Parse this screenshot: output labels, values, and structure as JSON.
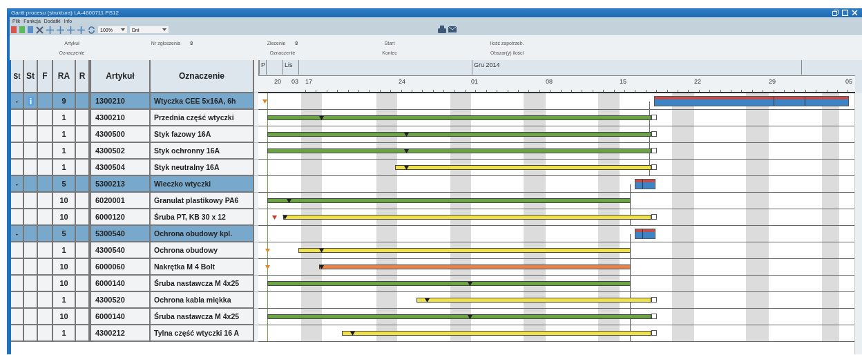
{
  "window": {
    "title": "Gantt procesu (struktura) LA-4600711 PS12"
  },
  "menu": [
    "Plik",
    "Funkcja",
    "Dodatki",
    "Info"
  ],
  "toolbar": {
    "zoom": "100%",
    "unit": "Dni"
  },
  "filters": [
    {
      "top": {
        "label": "Artykuł"
      },
      "bottom": {
        "label": "Oznaczenie"
      }
    },
    {
      "top": {
        "label": "Nr zgłoszenia",
        "value": "8"
      }
    },
    {
      "top": {
        "label": "Zlecenie",
        "value": "8"
      },
      "bottom": {
        "label": "Oznaczenie"
      }
    },
    {
      "top": {
        "label": "Start"
      },
      "bottom": {
        "label": "Koniec"
      }
    },
    {
      "top": {
        "label": "Ilość zapotrzeb."
      },
      "bottom": {
        "label": "Obszar(y) ilości"
      }
    }
  ],
  "columns": [
    "St",
    "St",
    "F",
    "RA",
    "R",
    "Artykuł",
    "Oznaczenie"
  ],
  "timeline": {
    "months": [
      "P",
      "Lis",
      "Gru 2014"
    ],
    "days": [
      "20",
      "03",
      "17",
      "24",
      "01",
      "08",
      "15",
      "22",
      "29",
      "05"
    ]
  },
  "rows": [
    {
      "kind": "summary",
      "expand": "-",
      "info": true,
      "ra": "9",
      "article": "1300210",
      "name": "Wtyczka CEE 5x16A, 6h",
      "markers": [
        {
          "color": "#d9822b"
        }
      ]
    },
    {
      "kind": "item",
      "ra": "1",
      "article": "4300210",
      "name": "Przednia część wtyczki",
      "color": "#6aa443",
      "markers": [
        {
          "color": "#1f1f1f"
        }
      ],
      "linked": true
    },
    {
      "kind": "item",
      "ra": "1",
      "article": "4300500",
      "name": "Styk fazowy 16A",
      "color": "#6aa443",
      "markers": [
        {
          "color": "#1f1f1f"
        }
      ],
      "linked": true
    },
    {
      "kind": "item",
      "ra": "1",
      "article": "4300502",
      "name": "Styk ochronny 16A",
      "color": "#6aa443",
      "markers": [
        {
          "color": "#1f1f1f"
        }
      ],
      "linked": true
    },
    {
      "kind": "item",
      "ra": "1",
      "article": "4300504",
      "name": "Styk neutralny 16A",
      "color": "#f0e04a",
      "markers": [
        {
          "color": "#1f1f1f"
        }
      ],
      "linked": true
    },
    {
      "kind": "summary",
      "expand": "-",
      "info": false,
      "ra": "5",
      "article": "5300213",
      "name": "Wieczko wtyczki"
    },
    {
      "kind": "item",
      "ra": "10",
      "article": "6020001",
      "name": "Granulat plastikowy PA6",
      "color": "#6aa443",
      "markers": [
        {
          "color": "#1f1f1f"
        }
      ],
      "linked": false
    },
    {
      "kind": "item",
      "ra": "10",
      "article": "6000120",
      "name": "Śruba PT, KB 30 x 12",
      "color": "#f0e04a",
      "markers": [
        {
          "color": "#c0392b"
        },
        {
          "color": "#1f1f1f"
        }
      ],
      "linked": true
    },
    {
      "kind": "summary",
      "expand": "-",
      "info": false,
      "ra": "5",
      "article": "5300540",
      "name": "Ochrona obudowy kpl."
    },
    {
      "kind": "item",
      "ra": "1",
      "article": "4300540",
      "name": "Ochrona obudowy",
      "color": "#f0e04a",
      "markers": [
        {
          "color": "#d98a2b"
        },
        {
          "color": "#1f1f1f"
        }
      ],
      "linked": false
    },
    {
      "kind": "item",
      "ra": "10",
      "article": "6000060",
      "name": "Nakrętka M 4  Bolt",
      "color": "#e8834a",
      "markers": [
        {
          "color": "#d98a2b"
        },
        {
          "color": "#1f1f1f"
        }
      ],
      "linked": false
    },
    {
      "kind": "item",
      "ra": "10",
      "article": "6000140",
      "name": "Śruba nastawcza M 4x25",
      "color": "#6aa443",
      "markers": [
        {
          "color": "#1f1f1f"
        }
      ],
      "linked": false
    },
    {
      "kind": "item",
      "ra": "1",
      "article": "4300520",
      "name": "Ochrona kabla miękka",
      "color": "#f0e04a",
      "markers": [
        {
          "color": "#1f1f1f"
        }
      ],
      "linked": true
    },
    {
      "kind": "item",
      "ra": "10",
      "article": "6000140",
      "name": "Śruba nastawcza M 4x25",
      "color": "#6aa443",
      "markers": [
        {
          "color": "#1f1f1f"
        }
      ],
      "linked": true
    },
    {
      "kind": "item",
      "ra": "1",
      "article": "4300212",
      "name": "Tylna część wtyczki 16 A",
      "color": "#f0e04a",
      "markers": [
        {
          "color": "#1f1f1f"
        }
      ],
      "linked": true
    }
  ]
}
